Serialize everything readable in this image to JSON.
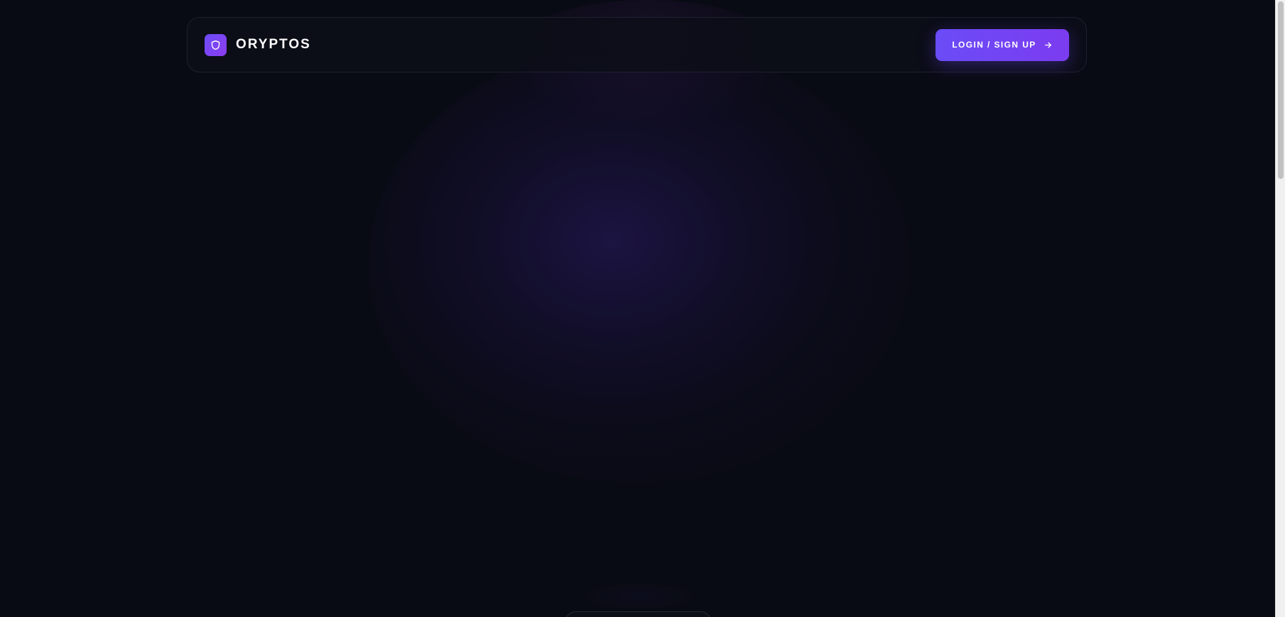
{
  "brand": {
    "name": "ORYPTOS",
    "logo_icon": "shield-icon",
    "logo_color": "#6d4cf7"
  },
  "header": {
    "cta_label": "LOGIN / SIGN UP",
    "cta_icon": "arrow-right-icon",
    "cta_color": "#6a4cf6"
  },
  "theme": {
    "background": "#090b14",
    "glow": "#3a228c"
  }
}
